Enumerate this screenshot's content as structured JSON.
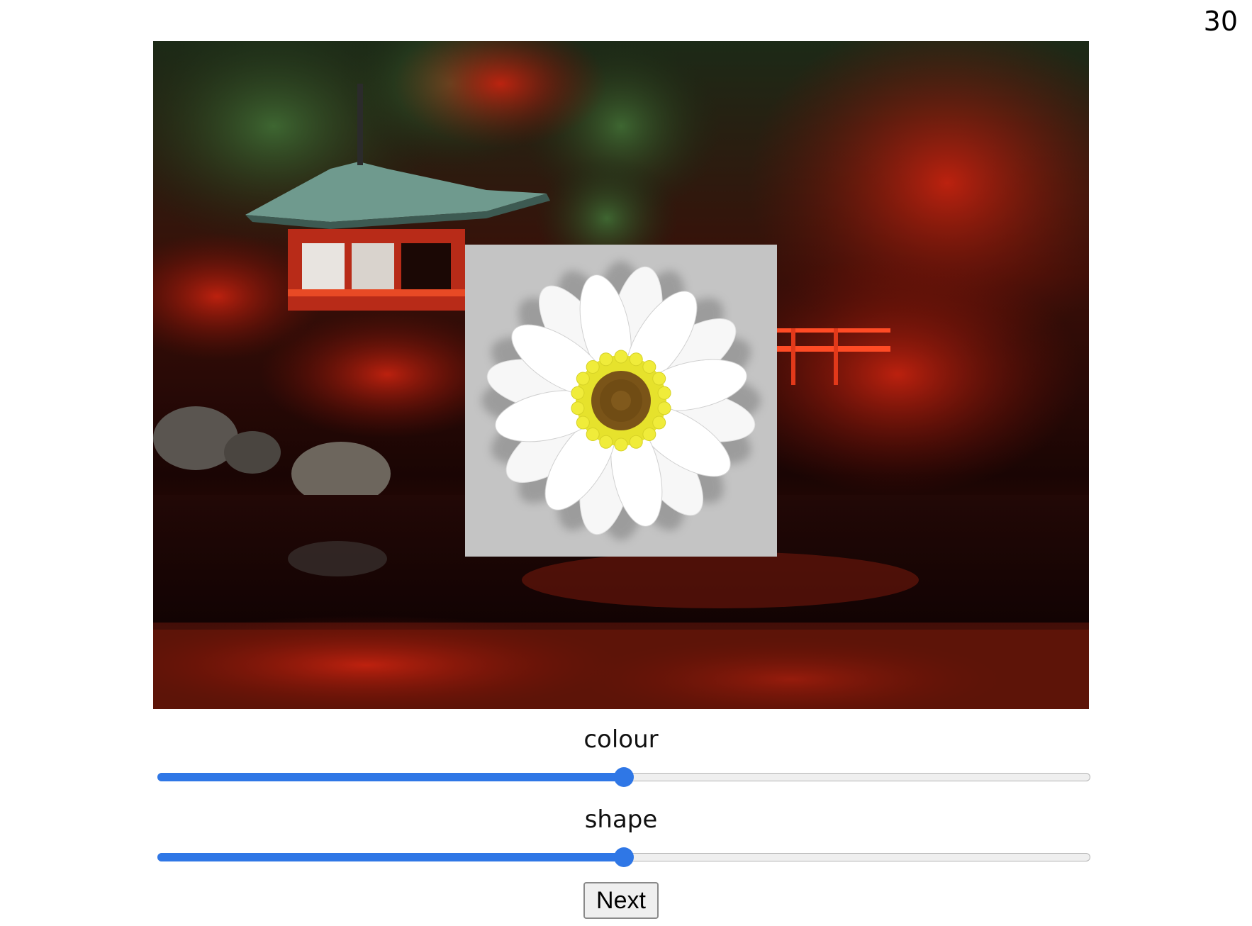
{
  "timer": {
    "value": "30"
  },
  "scene": {
    "background_icon": "temple-garden-photo",
    "stimulus_icon": "daisy-icon",
    "stimulus_box_color": "#c4c4c4"
  },
  "sliders": [
    {
      "label": "colour",
      "value": 0.5,
      "name": "colour"
    },
    {
      "label": "shape",
      "value": 0.5,
      "name": "shape"
    }
  ],
  "accent_color": "#2f77e6",
  "next_button": {
    "label": "Next"
  }
}
